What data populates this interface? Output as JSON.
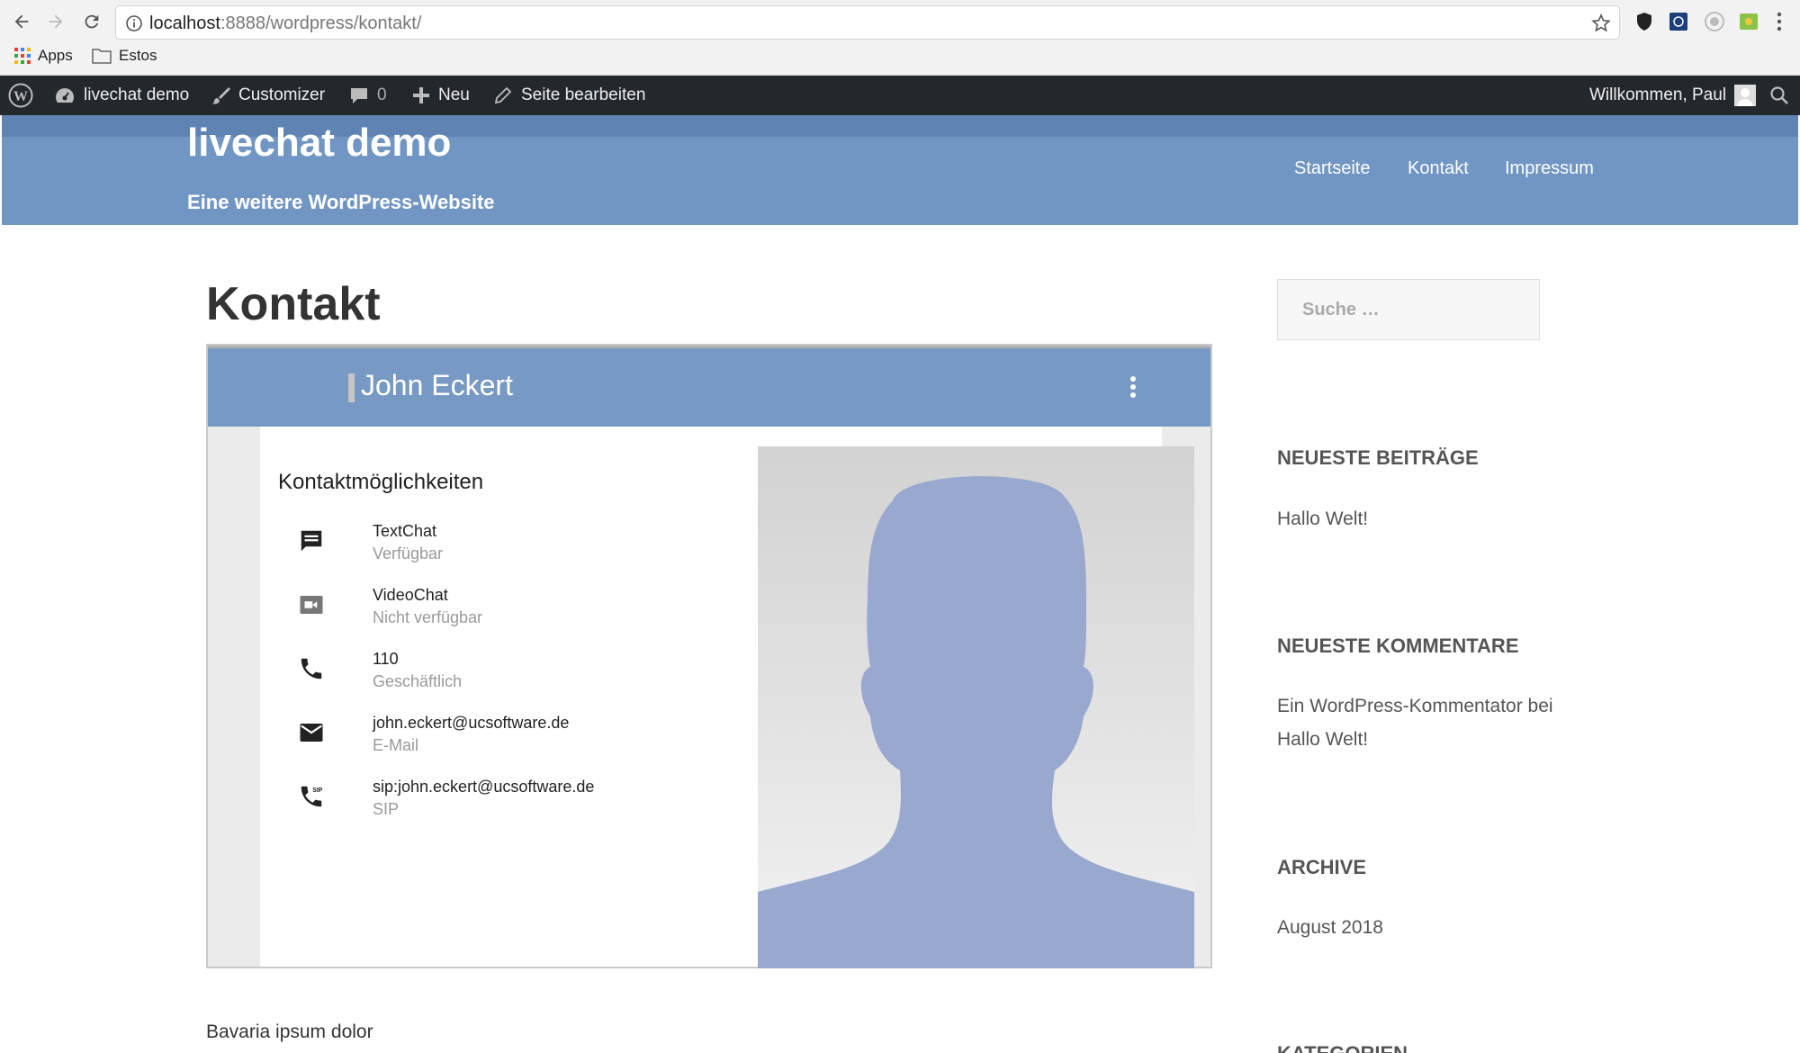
{
  "browser": {
    "url_host": "localhost",
    "url_rest": ":8888/wordpress/kontakt/",
    "bookmarks": [
      "Apps",
      "Estos"
    ]
  },
  "adminbar": {
    "site": "livechat demo",
    "customizer": "Customizer",
    "comments_count": "0",
    "new": "Neu",
    "edit_page": "Seite bearbeiten",
    "greeting": "Willkommen, Paul"
  },
  "site": {
    "title": "livechat demo",
    "description": "Eine weitere WordPress-Website",
    "nav": [
      "Startseite",
      "Kontakt",
      "Impressum"
    ]
  },
  "page": {
    "title": "Kontakt",
    "paragraph": "Bavaria ipsum dolor"
  },
  "card": {
    "name": "John Eckert",
    "section_title": "Kontaktmöglichkeiten",
    "contacts": [
      {
        "icon": "chat-icon",
        "value": "TextChat",
        "sub": "Verfügbar"
      },
      {
        "icon": "video-icon",
        "value": "VideoChat",
        "sub": "Nicht verfügbar"
      },
      {
        "icon": "phone-icon",
        "value": "110",
        "sub": "Geschäftlich"
      },
      {
        "icon": "mail-icon",
        "value": "john.eckert@ucsoftware.de",
        "sub": "E-Mail"
      },
      {
        "icon": "sip-phone-icon",
        "value": "sip:john.eckert@ucsoftware.de",
        "sub": "SIP"
      }
    ]
  },
  "sidebar": {
    "search_placeholder": "Suche …",
    "recent_posts_title": "NEUESTE BEITRÄGE",
    "recent_posts": [
      "Hallo Welt!"
    ],
    "recent_comments_title": "NEUESTE KOMMENTARE",
    "recent_comment": {
      "author": "Ein WordPress-Kommentator",
      "conj": "bei",
      "post": "Hallo Welt!"
    },
    "archive_title": "ARCHIVE",
    "archives": [
      "August 2018"
    ],
    "categories_title": "KATEGORIEN"
  },
  "colors": {
    "header_blue": "#7196c3",
    "card_header_blue": "#7799c3",
    "adminbar_dark": "#23282d",
    "avatar_silhouette": "#98a8cf"
  }
}
